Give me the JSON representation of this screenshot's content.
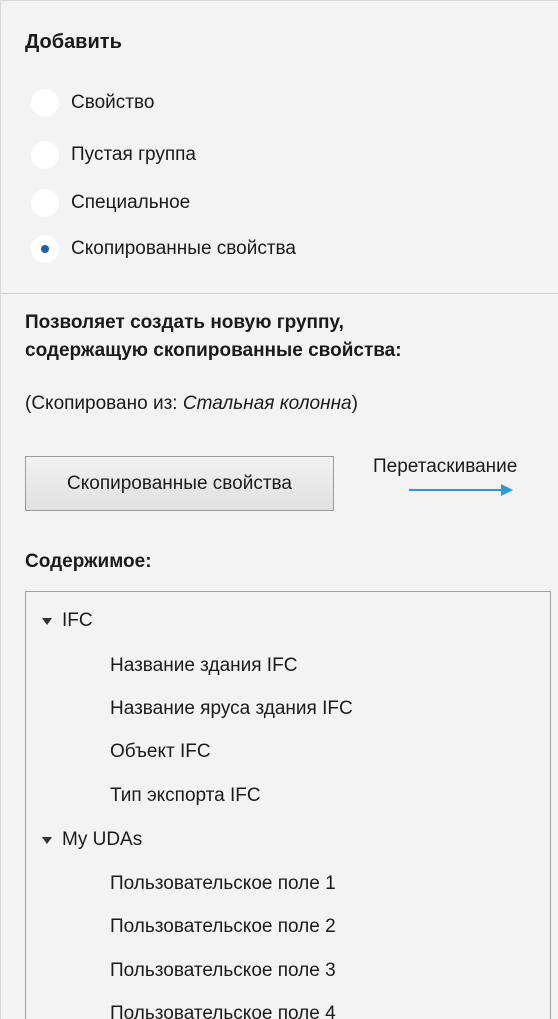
{
  "add_section": {
    "title": "Добавить",
    "options": [
      {
        "label": "Свойство",
        "checked": false
      },
      {
        "label": "Пустая группа",
        "checked": false
      },
      {
        "label": "Специальное",
        "checked": false
      },
      {
        "label": "Скопированные свойства",
        "checked": true
      }
    ]
  },
  "description": {
    "line1": "Позволяет создать новую группу,",
    "line2": "содержащую скопированные свойства:"
  },
  "copied_from": {
    "prefix": "(Скопировано из: ",
    "source": "Стальная колонна",
    "suffix": ")"
  },
  "copy_button": {
    "label": "Скопированные свойства"
  },
  "drag_hint": {
    "label": "Перетаскивание",
    "arrow_color": "#2b9bd6"
  },
  "contents": {
    "title": "Содержимое:",
    "groups": [
      {
        "label": "IFC",
        "items": [
          "Название здания IFC",
          "Название яруса здания IFC",
          "Объект IFC",
          "Тип экспорта IFC"
        ]
      },
      {
        "label": "My UDAs",
        "items": [
          "Пользовательское поле 1",
          "Пользовательское поле 2",
          "Пользовательское поле 3",
          "Пользовательское поле 4"
        ]
      }
    ]
  }
}
